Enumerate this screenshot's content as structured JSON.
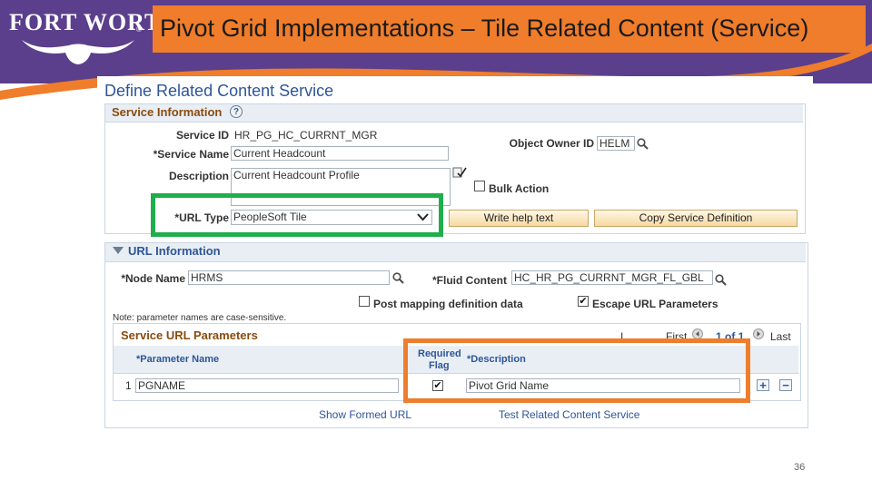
{
  "header": {
    "logo_text": "FORT WORTH",
    "logo_mark": "®",
    "title": "Pivot Grid Implementations – Tile Related Content (Service)"
  },
  "page": {
    "title": "Define Related Content Service",
    "page_number": "36"
  },
  "service_info": {
    "section_title": "Service Information",
    "help_icon": "?",
    "service_id_label": "Service ID",
    "service_id_value": "HR_PG_HC_CURRNT_MGR",
    "service_name_label": "*Service Name",
    "service_name_value": "Current Headcount",
    "description_label": "Description",
    "description_value": "Current Headcount Profile",
    "object_owner_label": "Object Owner ID",
    "object_owner_value": "HELM",
    "bulk_action_label": "Bulk Action",
    "bulk_action_checked": false,
    "url_type_label": "*URL Type",
    "url_type_value": "PeopleSoft Tile",
    "write_help_button": "Write help text",
    "copy_service_button": "Copy Service Definition"
  },
  "url_info": {
    "section_title": "URL Information",
    "node_name_label": "*Node Name",
    "node_name_value": "HRMS",
    "fluid_content_label": "*Fluid Content",
    "fluid_content_value": "HC_HR_PG_CURRNT_MGR_FL_GBL",
    "post_mapping_label": "Post mapping definition data",
    "post_mapping_checked": false,
    "escape_url_label": "Escape URL Parameters",
    "escape_url_checked": true,
    "note": "Note: parameter names are case-sensitive."
  },
  "params_grid": {
    "title": "Service URL Parameters",
    "nav_first_glyph": "I",
    "nav_first": "First",
    "nav_range": "1 of 1",
    "nav_last": "Last",
    "col_param_name": "*Parameter Name",
    "col_required_line1": "Required",
    "col_required_line2": "Flag",
    "col_description": "*Description",
    "rows": [
      {
        "row_num": "1",
        "param_name": "PGNAME",
        "required": true,
        "description": "Pivot Grid Name"
      }
    ],
    "add_glyph": "+",
    "remove_glyph": "−"
  },
  "links": {
    "show_formed_url": "Show Formed URL",
    "test_related": "Test Related Content Service"
  },
  "colors": {
    "brand_purple": "#5b3f8c",
    "brand_orange": "#ef7d2b",
    "highlight_green": "#1fae4b",
    "highlight_orange": "#ee7d2c"
  }
}
